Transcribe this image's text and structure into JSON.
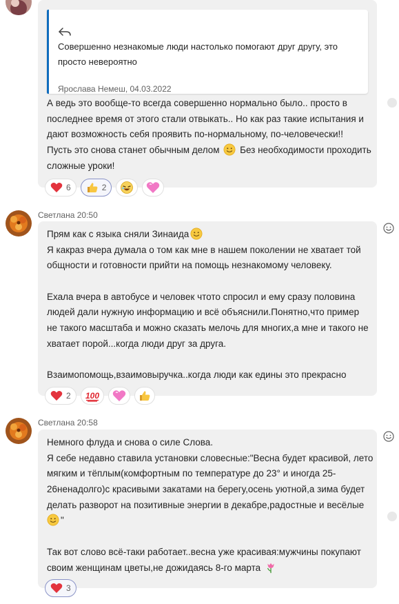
{
  "messages": [
    {
      "quote": {
        "text": "Совершенно незнакомые люди настолько помогают друг другу, это просто невероятно",
        "meta": "Ярослава Немеш, 04.03.2022"
      },
      "lines": [
        "А ведь это вообще-то всегда совершенно нормально было.. просто в",
        "последнее время от этого стали отвыкать.. Но как раз такие испытания и",
        "дают возможность себя проявить по-нормальному, по-человечески!!",
        "Пусть это снова станет обычным делом",
        "Без необходимости проходить",
        "сложные уроки!"
      ],
      "reactions": [
        {
          "icon": "heart-icon",
          "count": "6"
        },
        {
          "icon": "thumbs-up-icon",
          "count": "2"
        },
        {
          "icon": "laughing-face-icon",
          "count": ""
        },
        {
          "icon": "pink-heart-icon",
          "count": ""
        }
      ]
    },
    {
      "sender": "Светлана 20:50",
      "lines": [
        "Прям как с языка сняли Зинаида",
        "Я какраз вчера думала о том как мне в нашем поколении не хватает той",
        "общности и готовности прийти на помощь незнакомому человеку.",
        "",
        "Ехала вчера в автобусе и человек чтото спросил и ему сразу половина",
        "людей дали нужную информацию и всё объяснили.Понятно,что пример",
        "не такого масштаба и можно сказать мелочь для многих,а мне и такого не",
        "хватает порой...когда люди друг за друга.",
        "",
        "Взаимопомощь,взаимовыручка..когда люди как едины это прекрасно"
      ],
      "reactions": [
        {
          "icon": "heart-icon",
          "count": "2"
        },
        {
          "icon": "hundred-points-icon",
          "count": ""
        },
        {
          "icon": "pink-heart-icon",
          "count": ""
        },
        {
          "icon": "thumbs-up-icon",
          "count": ""
        }
      ]
    },
    {
      "sender": "Светлана 20:58",
      "lines": [
        "Немного флуда и снова о силе Слова.",
        "Я себе недавно ставила установки словесные:\"Весна будет красивой, лето",
        "мягким и тёплым(комфортным по температуре до 23° и иногда 25-",
        "26ненадолго)с красивыми закатами на берегу,осень уютной,а зима будет",
        "делать разворот на позитивные энергии в декабре,радостные и весёлые",
        "\"",
        "",
        "Так вот слово всё-таки работает..весна уже красивая:мужчины покупают",
        "своим женщинам цветы,не дожидаясь 8-го марта"
      ],
      "reactions": [
        {
          "icon": "heart-icon",
          "count": "3"
        }
      ]
    }
  ]
}
